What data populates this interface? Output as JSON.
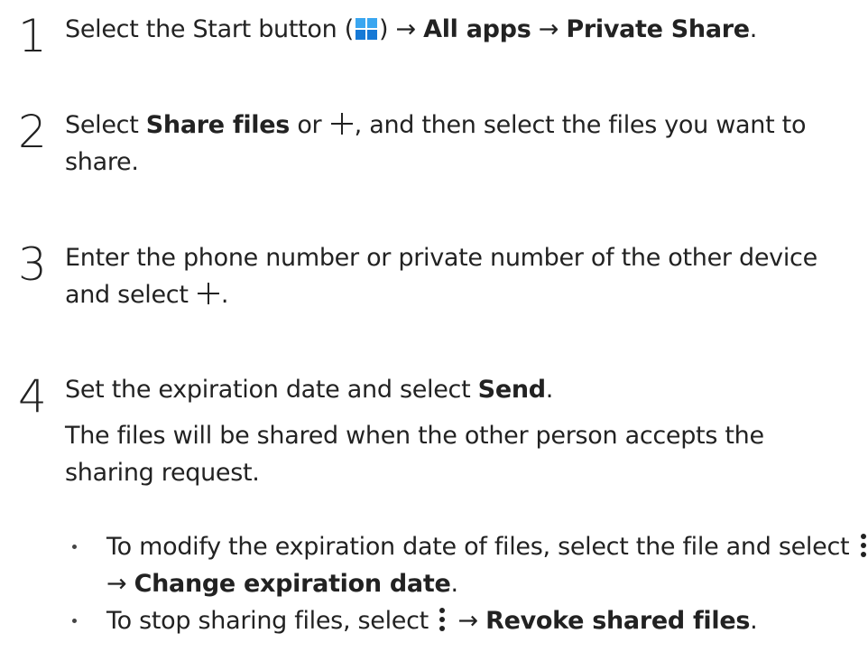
{
  "steps": [
    {
      "number": "1",
      "part1": "Select the Start button (",
      "part2": ") → ",
      "bold1": "All apps",
      "part3": " → ",
      "bold2": "Private Share",
      "part4": "."
    },
    {
      "number": "2",
      "part1": "Select ",
      "bold1": "Share files",
      "part2": " or ",
      "part3": ", and then select the files you want to share."
    },
    {
      "number": "3",
      "part1": "Enter the phone number or private number of the other device and select ",
      "part2": "."
    },
    {
      "number": "4",
      "part1": "Set the expiration date and select ",
      "bold1": "Send",
      "part2": ".",
      "note": "The files will be shared when the other person accepts the sharing request."
    }
  ],
  "bullets": [
    {
      "part1": "To modify the expiration date of files, select the file and select ",
      "part2": " → ",
      "bold1": "Change expiration date",
      "part3": "."
    },
    {
      "part1": "To stop sharing files, select ",
      "part2": " → ",
      "bold1": "Revoke shared files",
      "part3": "."
    }
  ],
  "icons": {
    "start": "windows-start-icon",
    "plus": "plus-icon",
    "more": "more-options-icon"
  },
  "colors": {
    "text": "#222222",
    "windows_blue": "#1e8be6"
  }
}
